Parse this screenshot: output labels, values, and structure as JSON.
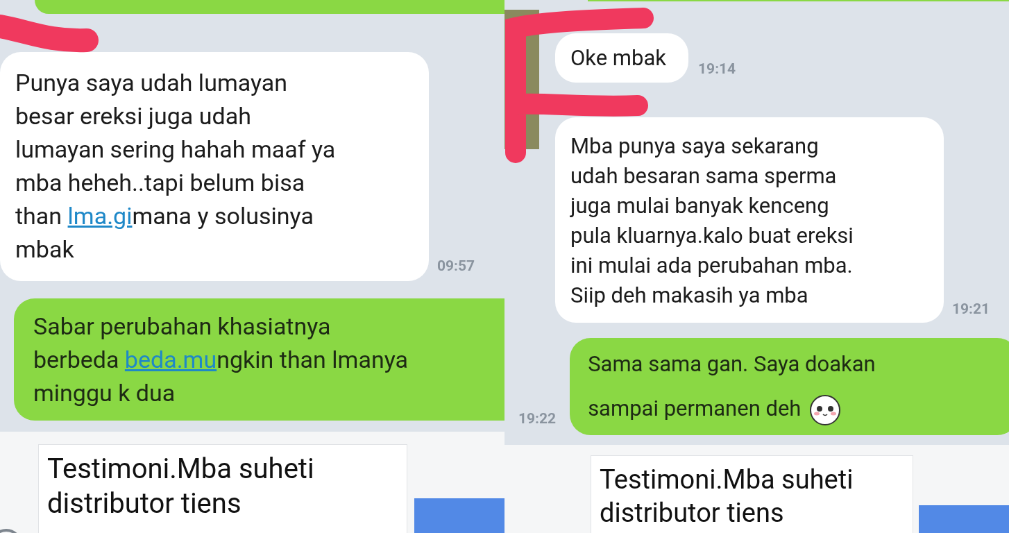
{
  "panels": [
    {
      "avatar": false,
      "messages": [
        {
          "kind": "partial"
        },
        {
          "kind": "incoming",
          "time": "09:57",
          "segments": [
            {
              "kind": "plain",
              "text": "Punya saya udah lumayan\nbesar ereksi juga udah\nlumayan sering hahah maaf ya\nmba heheh..tapi belum bisa\nthan "
            },
            {
              "kind": "link",
              "text": "lma.gi"
            },
            {
              "kind": "plain",
              "text": "mana y solusinya\nmbak"
            }
          ]
        },
        {
          "kind": "outgoing",
          "emoji": false,
          "segments": [
            {
              "kind": "plain",
              "text": "Sabar perubahan khasiatnya\nberbeda "
            },
            {
              "kind": "link",
              "text": "beda.mu"
            },
            {
              "kind": "plain",
              "text": "ngkin than lmanya\nminggu k dua"
            }
          ]
        }
      ],
      "composer": {
        "value": "Testimoni.Mba suheti\ndistributor tiens"
      }
    },
    {
      "avatar": true,
      "messages": [
        {
          "kind": "partial"
        },
        {
          "kind": "incoming",
          "time": "19:14",
          "segments": [
            {
              "kind": "plain",
              "text": "Oke mbak"
            }
          ]
        },
        {
          "kind": "incoming",
          "time": "19:21",
          "segments": [
            {
              "kind": "plain",
              "text": "Mba punya saya sekarang\nudah besaran sama sperma\njuga mulai banyak kenceng\npula kluarnya.kalo buat ereksi\nini mulai ada perubahan mba.\nSiip deh makasih ya mba"
            }
          ]
        },
        {
          "kind": "outgoing",
          "time": "19:22",
          "emoji": true,
          "segments": [
            {
              "kind": "plain",
              "text": "Sama sama gan. Saya doakan\nsampai permanen deh"
            }
          ]
        }
      ],
      "composer": {
        "value": "Testimoni.Mba suheti\ndistributor tiens"
      }
    }
  ]
}
